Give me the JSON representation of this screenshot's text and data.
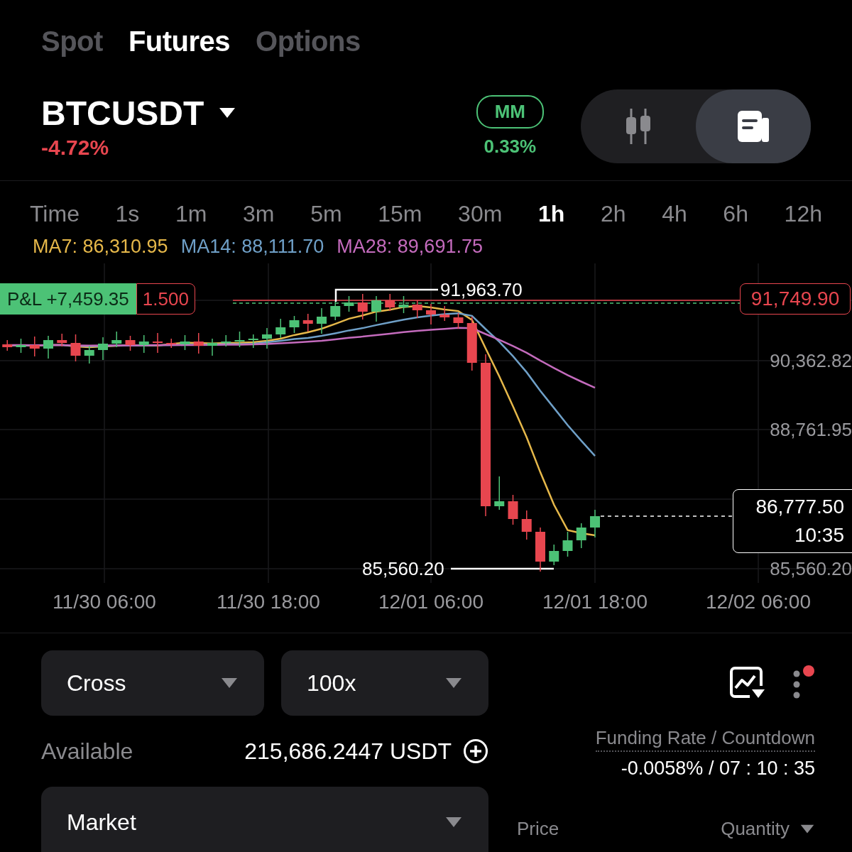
{
  "market_tabs": [
    {
      "label": "Spot",
      "selected": false
    },
    {
      "label": "Futures",
      "selected": true
    },
    {
      "label": "Options",
      "selected": false
    }
  ],
  "symbol": {
    "name": "BTCUSDT",
    "change": "-4.72%"
  },
  "margin_mode": {
    "badge": "MM",
    "value": "0.33%"
  },
  "view_toggle": [
    {
      "kind": "chart",
      "selected": false
    },
    {
      "kind": "orders",
      "selected": true
    }
  ],
  "intervals": [
    {
      "label": "Time",
      "selected": false
    },
    {
      "label": "1s",
      "selected": false
    },
    {
      "label": "1m",
      "selected": false
    },
    {
      "label": "3m",
      "selected": false
    },
    {
      "label": "5m",
      "selected": false
    },
    {
      "label": "15m",
      "selected": false
    },
    {
      "label": "30m",
      "selected": false
    },
    {
      "label": "1h",
      "selected": true
    },
    {
      "label": "2h",
      "selected": false
    },
    {
      "label": "4h",
      "selected": false
    },
    {
      "label": "6h",
      "selected": false
    },
    {
      "label": "12h",
      "selected": false
    }
  ],
  "moving_averages": [
    {
      "label": "MA7: 86,310.95",
      "color": "#e6b84a"
    },
    {
      "label": "MA14: 88,111.70",
      "color": "#6fa0c8"
    },
    {
      "label": "MA28: 89,691.75",
      "color": "#c46bbd"
    }
  ],
  "chart": {
    "position": {
      "pnl": "P&L +7,459.35",
      "size": "1.500",
      "entry": "91,749.90"
    },
    "high": "91,963.70",
    "low": "85,560.20",
    "price_axis": [
      "90,362.82",
      "88,761.95",
      "85,560.20"
    ],
    "last": {
      "price": "86,777.50",
      "countdown": "10:35"
    },
    "time_axis": [
      "11/30 06:00",
      "11/30 18:00",
      "12/01 06:00",
      "12/01 18:00",
      "12/02 06:00"
    ]
  },
  "order_form": {
    "margin": "Cross",
    "leverage": "100x",
    "available_label": "Available",
    "available_value": "215,686.2447 USDT",
    "order_type": "Market"
  },
  "side_panel": {
    "menu_badge": true,
    "funding_label": "Funding Rate / Countdown",
    "funding_value": "-0.0058% / 07 : 10 : 35",
    "columns": [
      "Price",
      "Quantity"
    ]
  }
}
